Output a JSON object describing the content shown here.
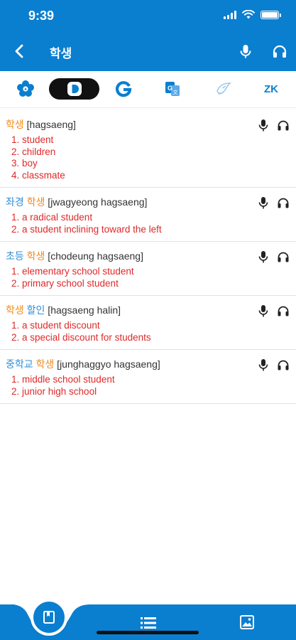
{
  "status": {
    "time": "9:39"
  },
  "header": {
    "title": "학생",
    "back_icon": "chevron-left-icon",
    "mic_icon": "microphone-icon",
    "headphones_icon": "headphones-icon"
  },
  "sources": [
    {
      "name": "flower-logo-icon"
    },
    {
      "name": "daum-d-icon",
      "active": true
    },
    {
      "name": "google-g-icon"
    },
    {
      "name": "translate-icon"
    },
    {
      "name": "papago-bird-icon"
    },
    {
      "label": "ZK"
    }
  ],
  "entries": [
    {
      "words": [
        {
          "t": "학생",
          "c": "orange"
        }
      ],
      "roman": " [hagsaeng]",
      "defs": [
        "1. student",
        "2. children",
        "3. boy",
        "4. classmate"
      ]
    },
    {
      "words": [
        {
          "t": "좌경 ",
          "c": "blue"
        },
        {
          "t": "학생",
          "c": "orange"
        }
      ],
      "roman": " [jwagyeong hagsaeng]",
      "defs": [
        "1. a radical student",
        "2. a student inclining toward the left"
      ]
    },
    {
      "words": [
        {
          "t": "초등 ",
          "c": "blue"
        },
        {
          "t": "학생",
          "c": "orange"
        }
      ],
      "roman": " [chodeung hagsaeng]",
      "defs": [
        "1. elementary school student",
        "2. primary school student"
      ]
    },
    {
      "words": [
        {
          "t": "학생 ",
          "c": "orange"
        },
        {
          "t": "할인",
          "c": "blue"
        }
      ],
      "roman": " [hagsaeng halin]",
      "defs": [
        "1. a student discount",
        "2. a special discount for students"
      ]
    },
    {
      "words": [
        {
          "t": "중학교 ",
          "c": "blue"
        },
        {
          "t": "학생",
          "c": "orange"
        }
      ],
      "roman": " [junghaggyo hagsaeng]",
      "defs": [
        "1. middle school student",
        "2. junior high school"
      ]
    }
  ],
  "tabs": [
    {
      "name": "dictionary-book-icon",
      "active": true
    },
    {
      "name": "list-icon"
    },
    {
      "name": "image-icon"
    }
  ],
  "colors": {
    "primary": "#0a7fd0",
    "keyword": "#f28a1b",
    "related": "#2f8fd8",
    "definition": "#e02828"
  }
}
